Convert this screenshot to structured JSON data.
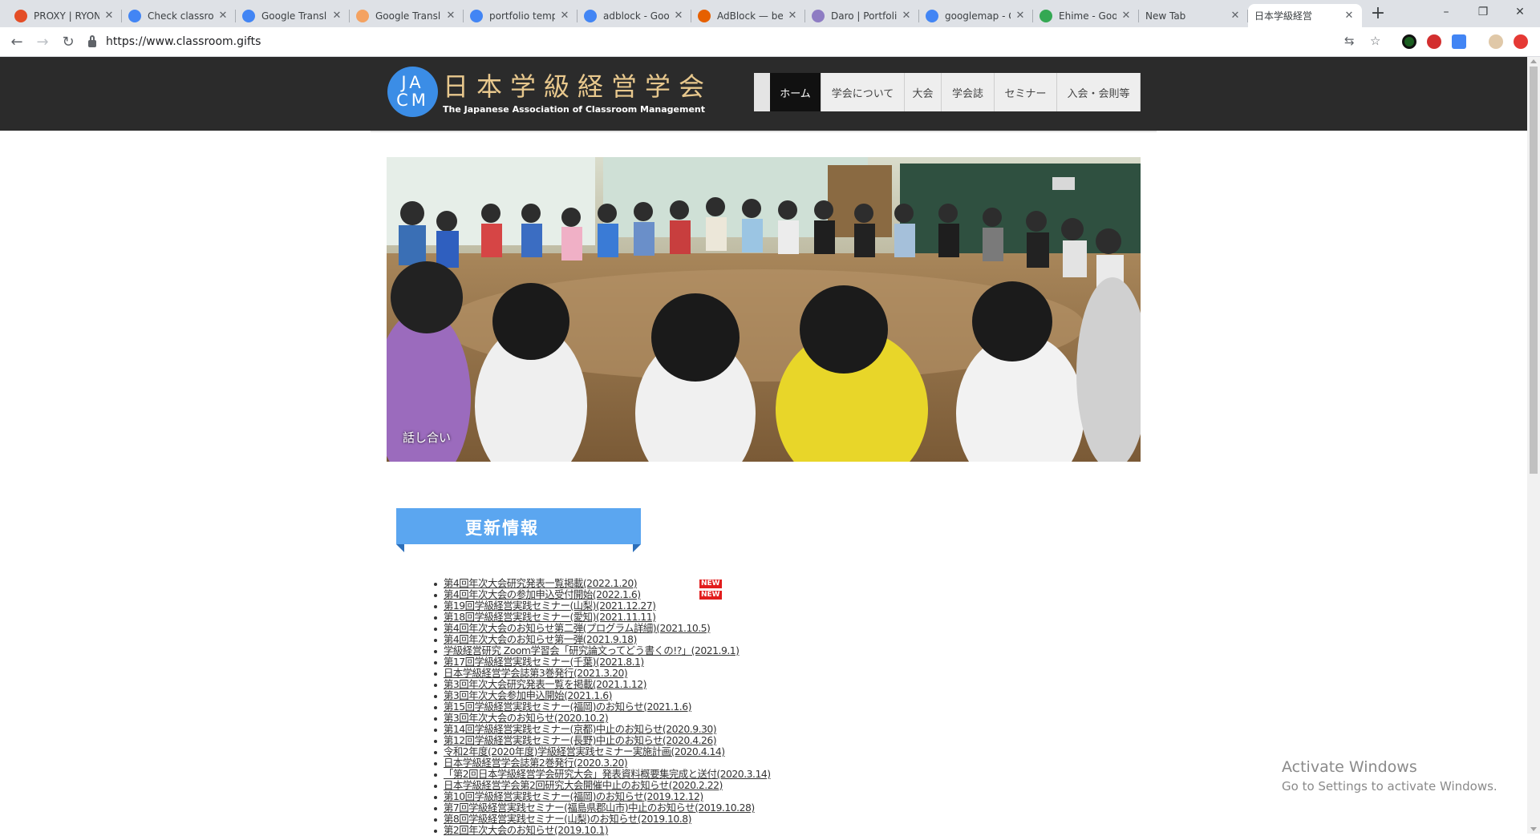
{
  "browser": {
    "tabs": [
      {
        "title": "PROXY | RYON",
        "fav": "brand-fox-icon",
        "color": "#e44d26"
      },
      {
        "title": "Check classro",
        "fav": "check-shield-icon",
        "color": "#4285f4"
      },
      {
        "title": "Google Transl",
        "fav": "translate-icon",
        "color": "#4285f4"
      },
      {
        "title": "Google Transl",
        "fav": "sheets-icon",
        "color": "#f4a261"
      },
      {
        "title": "portfolio temp",
        "fav": "google-g-icon",
        "color": "#4285f4"
      },
      {
        "title": "adblock - Goo",
        "fav": "google-g-icon",
        "color": "#4285f4"
      },
      {
        "title": "AdBlock — be",
        "fav": "firefox-icon",
        "color": "#e66000"
      },
      {
        "title": "Daro | Portfoli",
        "fav": "daro-icon",
        "color": "#8e7cc3"
      },
      {
        "title": "googlemap - G",
        "fav": "google-g-icon",
        "color": "#4285f4"
      },
      {
        "title": "Ehime - Googl",
        "fav": "maps-pin-icon",
        "color": "#34a853"
      },
      {
        "title": "New Tab",
        "fav": "",
        "color": ""
      },
      {
        "title": "日本学級経営",
        "fav": "",
        "color": ""
      }
    ],
    "url": "https://www.classroom.gifts"
  },
  "site": {
    "logo_mark": "JA CM",
    "title": "日本学級経営学会",
    "subtitle": "The Japanese Association of Classroom Management",
    "nav": [
      "ホーム",
      "学会について",
      "大会",
      "学会誌",
      "セミナー",
      "入会・会則等"
    ],
    "hero_caption": "話し合い",
    "section_title": "更新情報",
    "news": [
      {
        "text": "第4回年次大会研究発表一覧掲載(2022.1.20)",
        "new": true
      },
      {
        "text": "第4回年次大会の参加申込受付開始(2022.1.6)",
        "new": true
      },
      {
        "text": "第19回学級経営実践セミナー(山梨)(2021.12.27)",
        "new": false
      },
      {
        "text": "第18回学級経営実践セミナー(愛知)(2021.11.11)",
        "new": false
      },
      {
        "text": "第4回年次大会のお知らせ第二弾(プログラム詳細)(2021.10.5)",
        "new": false
      },
      {
        "text": "第4回年次大会のお知らせ第一弾(2021.9.18)",
        "new": false
      },
      {
        "text": "学級経営研究 Zoom学習会「研究論文ってどう書くの!?」(2021.9.1)",
        "new": false
      },
      {
        "text": "第17回学級経営実践セミナー(千葉)(2021.8.1)",
        "new": false
      },
      {
        "text": "日本学級経営学会誌第3巻発行(2021.3.20)",
        "new": false
      },
      {
        "text": "第3回年次大会研究発表一覧を掲載(2021.1.12)",
        "new": false
      },
      {
        "text": "第3回年次大会参加申込開始(2021.1.6)",
        "new": false
      },
      {
        "text": "第15回学級経営実践セミナー(福岡)のお知らせ(2021.1.6)",
        "new": false
      },
      {
        "text": "第3回年次大会のお知らせ(2020.10.2)",
        "new": false
      },
      {
        "text": "第14回学級経営実践セミナー(京都)中止のお知らせ(2020.9.30)",
        "new": false
      },
      {
        "text": "第12回学級経営実践セミナー(長野)中止のお知らせ(2020.4.26)",
        "new": false
      },
      {
        "text": "令和2年度(2020年度)学級経営実践セミナー実施計画(2020.4.14)",
        "new": false
      },
      {
        "text": "日本学級経営学会誌第2巻発行(2020.3.20)",
        "new": false
      },
      {
        "text": "「第2回日本学級経営学会研究大会」発表資料概要集完成と送付(2020.3.14)",
        "new": false
      },
      {
        "text": "日本学級経営学会第2回研究大会開催中止のお知らせ(2020.2.22)",
        "new": false
      },
      {
        "text": "第10回学級経営実践セミナー(福岡)のお知らせ(2019.12.12)",
        "new": false
      },
      {
        "text": "第7回学級経営実践セミナー(福島県郡山市)中止のお知らせ(2019.10.28)",
        "new": false
      },
      {
        "text": "第8回学級経営実践セミナー(山梨)のお知らせ(2019.10.8)",
        "new": false
      },
      {
        "text": "第2回年次大会のお知らせ(2019.10.1)",
        "new": false
      }
    ],
    "new_badge": "NEW"
  },
  "os": {
    "activate_title": "Activate Windows",
    "activate_sub": "Go to Settings to activate Windows."
  }
}
